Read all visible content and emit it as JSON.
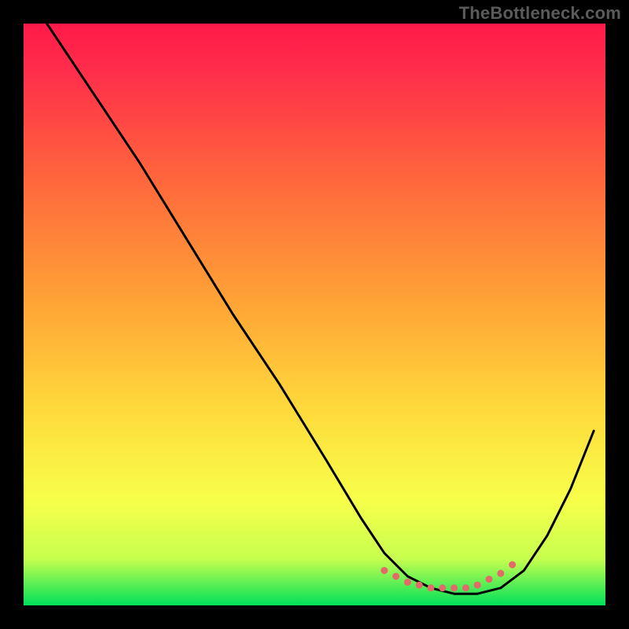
{
  "watermark": "TheBottleneck.com",
  "chart_data": {
    "type": "line",
    "title": "",
    "xlabel": "",
    "ylabel": "",
    "xlim": [
      0,
      100
    ],
    "ylim": [
      0,
      100
    ],
    "grid": false,
    "legend": false,
    "gradient_background": {
      "top_color": "#ff1a4a",
      "mid_color": "#ffd93b",
      "bottom_color": "#00e05a"
    },
    "series": [
      {
        "name": "curve",
        "stroke": "#000000",
        "x": [
          4,
          12,
          20,
          28,
          36,
          44,
          52,
          58,
          62,
          66,
          70,
          74,
          78,
          82,
          86,
          90,
          94,
          98
        ],
        "y": [
          100,
          88,
          76,
          63,
          50,
          38,
          25,
          15,
          9,
          5,
          3,
          2,
          2,
          3,
          6,
          12,
          20,
          30
        ]
      },
      {
        "name": "marker-band",
        "type": "scatter",
        "stroke": "#e26a6a",
        "x": [
          62,
          64,
          66,
          68,
          70,
          72,
          74,
          76,
          78,
          80,
          82,
          84
        ],
        "y": [
          6,
          5,
          4,
          3.5,
          3,
          3,
          3,
          3,
          3.5,
          4.5,
          5.5,
          7
        ]
      }
    ],
    "notes": "Heat-gradient background from red (top) through yellow to green (bottom). A single black curve descends steeply from top-left, reaches a flat minimum near x≈70-80 (highlighted with salmon markers), then rises toward the right edge."
  }
}
